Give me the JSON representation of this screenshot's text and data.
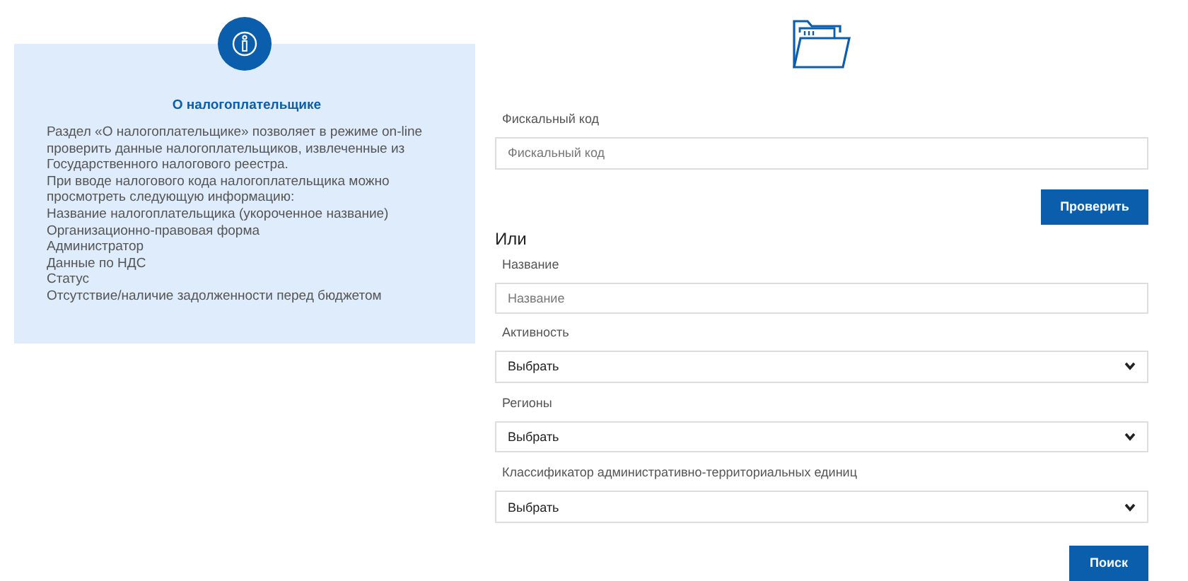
{
  "info_panel": {
    "title": "О налогоплательщике",
    "paragraphs": [
      "Раздел «О налогоплательщике» позволяет в режиме on-line проверить данные налогоплательщиков, извлеченные из Государственного налогового реестра.",
      "При вводе налогового кода налогоплательщика можно просмотреть следующую информацию:"
    ],
    "items": [
      "Название налогоплательщика (укороченное название)",
      "Организационно-правовая форма",
      "Администратор",
      "Данные по НДС",
      "Статус",
      "Отсутствие/наличие задолженности перед бюджетом"
    ]
  },
  "form": {
    "fiscal": {
      "label": "Фискальный код",
      "placeholder": "Фискальный код"
    },
    "check_button": "Проверить",
    "or_label": "Или",
    "fields": [
      {
        "kind": "input",
        "label": "Название",
        "placeholder": "Название"
      },
      {
        "kind": "select",
        "label": "Активность",
        "value": "Выбрать"
      },
      {
        "kind": "select",
        "label": "Регионы",
        "value": "Выбрать"
      },
      {
        "kind": "select",
        "label": "Классификатор административно-территориальных единиц",
        "value": "Выбрать"
      }
    ],
    "search_button": "Поиск"
  }
}
